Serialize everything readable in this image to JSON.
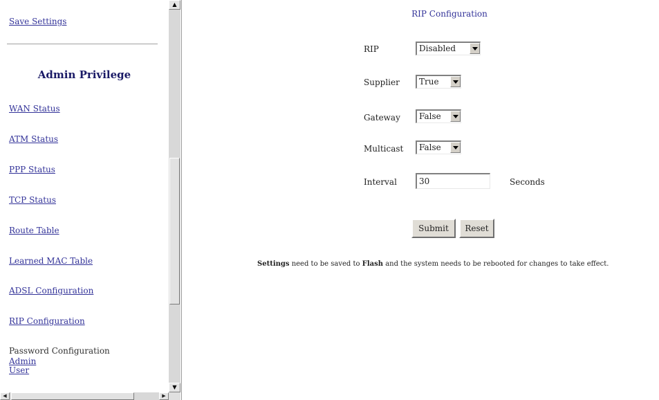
{
  "sidebar": {
    "save_settings": "Save Settings",
    "heading": "Admin Privilege",
    "links": [
      "WAN Status",
      "ATM Status",
      "PPP Status",
      "TCP Status",
      "Route Table",
      "Learned MAC Table",
      "ADSL Configuration",
      "RIP Configuration"
    ],
    "password_config": "Password Configuration",
    "password_admin": "Admin",
    "password_user": "User"
  },
  "main": {
    "title": "RIP Configuration",
    "fields": {
      "rip": {
        "label": "RIP",
        "value": "Disabled"
      },
      "supplier": {
        "label": "Supplier",
        "value": "True"
      },
      "gateway": {
        "label": "Gateway",
        "value": "False"
      },
      "multicast": {
        "label": "Multicast",
        "value": "False"
      },
      "interval": {
        "label": "Interval",
        "value": "30",
        "unit": "Seconds"
      }
    },
    "submit_label": "Submit",
    "reset_label": "Reset",
    "notice": {
      "part1": "Settings",
      "part2": " need to be saved to ",
      "part3": "Flash",
      "part4": " and the system needs to be rebooted for changes to take effect."
    }
  }
}
